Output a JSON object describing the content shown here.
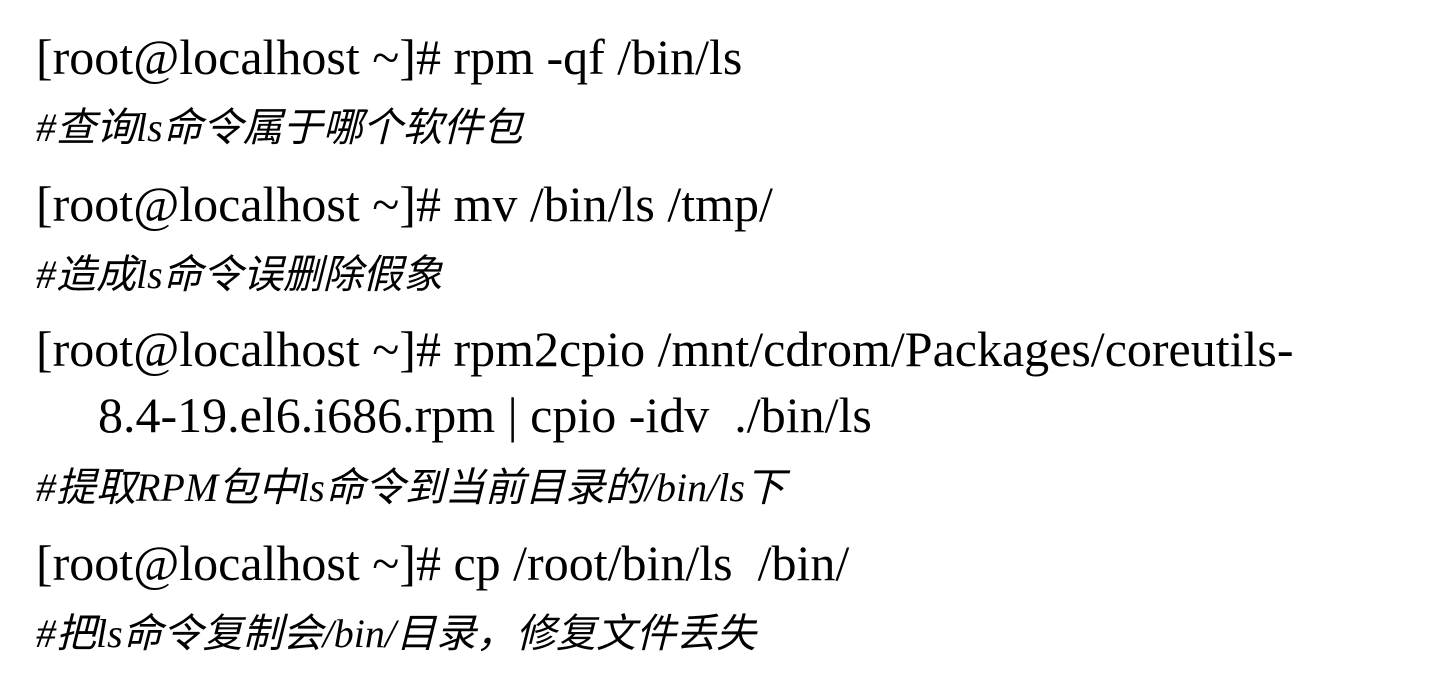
{
  "blocks": [
    {
      "command": "[root@localhost ~]# rpm -qf /bin/ls",
      "comment": "#查询ls命令属于哪个软件包"
    },
    {
      "command": "[root@localhost ~]# mv /bin/ls /tmp/",
      "comment": "#造成ls命令误删除假象"
    },
    {
      "command": "[root@localhost ~]# rpm2cpio /mnt/cdrom/Packages/coreutils-",
      "command_cont": "8.4-19.el6.i686.rpm | cpio -idv  ./bin/ls",
      "comment": "#提取RPM包中ls命令到当前目录的/bin/ls下"
    },
    {
      "command": "[root@localhost ~]# cp /root/bin/ls  /bin/",
      "comment": "#把ls命令复制会/bin/目录，修复文件丢失"
    }
  ]
}
